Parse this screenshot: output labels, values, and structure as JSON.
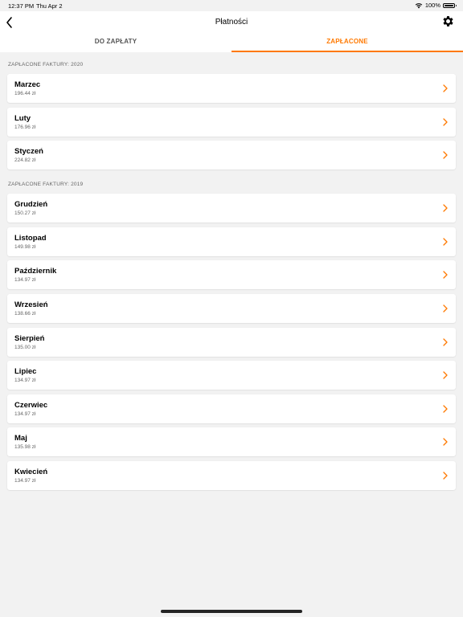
{
  "status_bar": {
    "time": "12:37 PM",
    "date": "Thu Apr 2",
    "battery": "100%"
  },
  "header": {
    "title": "Płatności"
  },
  "tabs": {
    "unpaid": "DO ZAPŁATY",
    "paid": "ZAPŁACONE"
  },
  "colors": {
    "accent": "#ff7900"
  },
  "sections": [
    {
      "title": "ZAPŁACONE FAKTURY: 2020",
      "items": [
        {
          "month": "Marzec",
          "amount": "196.44 zł"
        },
        {
          "month": "Luty",
          "amount": "176.96 zł"
        },
        {
          "month": "Styczeń",
          "amount": "224.82 zł"
        }
      ]
    },
    {
      "title": "ZAPŁACONE FAKTURY: 2019",
      "items": [
        {
          "month": "Grudzień",
          "amount": "150.27 zł"
        },
        {
          "month": "Listopad",
          "amount": "149.98 zł"
        },
        {
          "month": "Październik",
          "amount": "134.97 zł"
        },
        {
          "month": "Wrzesień",
          "amount": "138.66 zł"
        },
        {
          "month": "Sierpień",
          "amount": "135.00 zł"
        },
        {
          "month": "Lipiec",
          "amount": "134.97 zł"
        },
        {
          "month": "Czerwiec",
          "amount": "134.97 zł"
        },
        {
          "month": "Maj",
          "amount": "135.98 zł"
        },
        {
          "month": "Kwiecień",
          "amount": "134.97 zł"
        }
      ]
    }
  ]
}
